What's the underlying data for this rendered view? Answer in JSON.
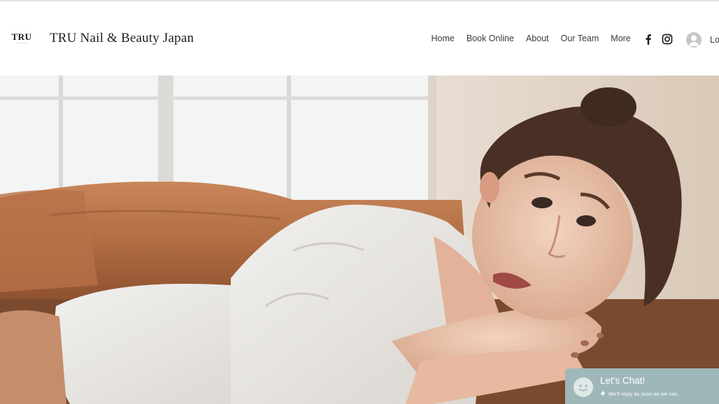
{
  "header": {
    "logo_mark": "TRU",
    "site_title": "TRU Nail & Beauty Japan",
    "nav": [
      {
        "label": "Home"
      },
      {
        "label": "Book Online"
      },
      {
        "label": "About"
      },
      {
        "label": "Our Team"
      },
      {
        "label": "More"
      }
    ],
    "social_icons": [
      "facebook-icon",
      "instagram-icon"
    ],
    "login_label": "Lo"
  },
  "hero": {
    "image": "woman-resting-on-sofa-photo"
  },
  "chat": {
    "title": "Let's Chat!",
    "subtitle": "We'll reply as soon as we can",
    "accent": "#9fb7b9"
  }
}
